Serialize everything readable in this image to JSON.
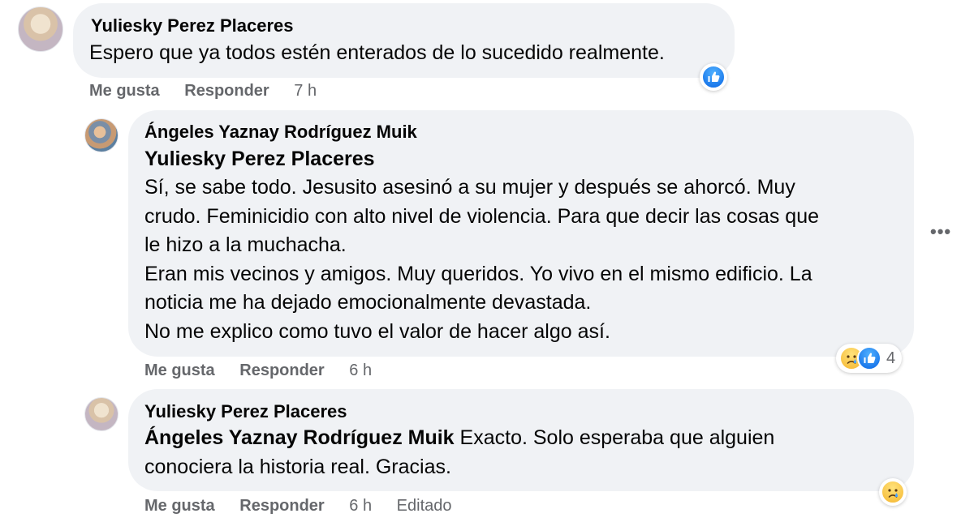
{
  "comments": [
    {
      "author": "Yuliesky Perez Placeres",
      "text": "Espero que ya todos estén enterados de lo sucedido realmente.",
      "actions": {
        "like": "Me gusta",
        "reply": "Responder",
        "time": "7 h"
      }
    },
    {
      "author": "Ángeles Yaznay Rodríguez Muik",
      "mention": "Yuliesky Perez Placeres",
      "lines": [
        "Sí, se sabe todo. Jesusito asesinó a su mujer y después se ahorcó. Muy",
        "crudo. Feminicidio con alto nivel de violencia. Para que decir las cosas que",
        "le hizo a la muchacha.",
        "Eran mis vecinos y amigos. Muy queridos. Yo vivo en el mismo edificio. La",
        "noticia me ha dejado emocionalmente devastada.",
        "No me explico como tuvo el valor de hacer algo así."
      ],
      "reaction_count": "4",
      "actions": {
        "like": "Me gusta",
        "reply": "Responder",
        "time": "6 h"
      }
    },
    {
      "author": "Yuliesky Perez Placeres",
      "mention": "Ángeles Yaznay Rodríguez Muik",
      "text_line1": " Exacto. Solo esperaba que alguien",
      "text_line2": "conociera la historia real. Gracias.",
      "actions": {
        "like": "Me gusta",
        "reply": "Responder",
        "time": "6 h",
        "edited": "Editado"
      }
    }
  ],
  "more_icon": "more-options-icon",
  "colors": {
    "bubble": "#f0f2f5",
    "meta": "#65676b",
    "like": "#0a66e4",
    "sad": "#f5b62f"
  }
}
